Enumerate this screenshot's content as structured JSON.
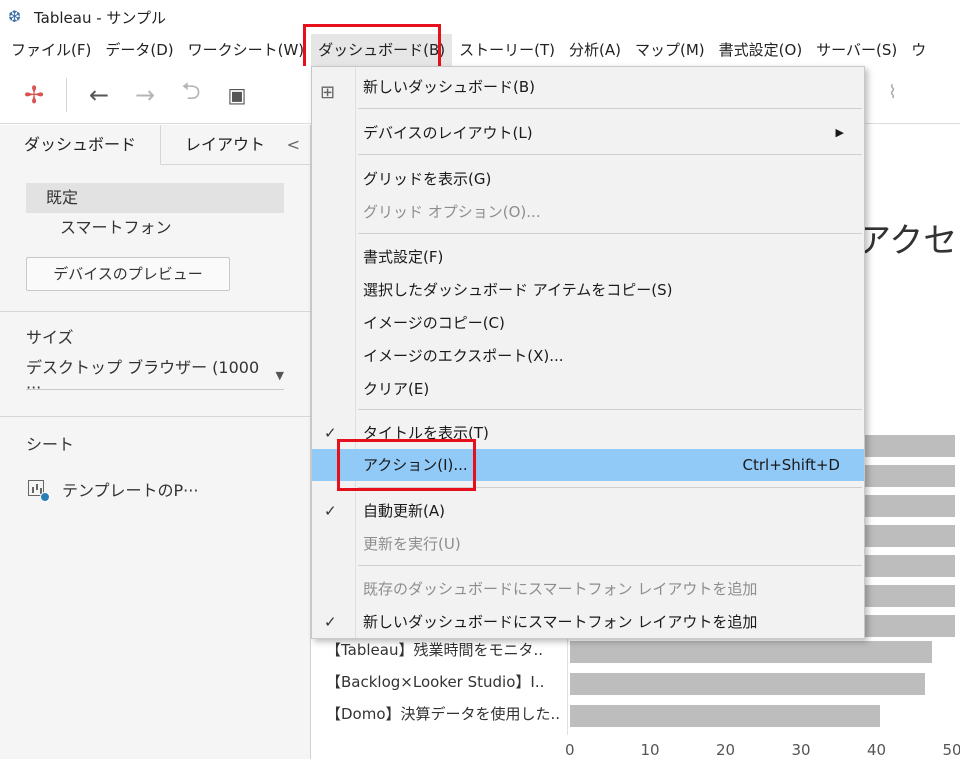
{
  "window": {
    "title": "Tableau - サンプル"
  },
  "menubar": [
    "ファイル(F)",
    "データ(D)",
    "ワークシート(W)",
    "ダッシュボード(B)",
    "ストーリー(T)",
    "分析(A)",
    "マップ(M)",
    "書式設定(O)",
    "サーバー(S)",
    "ウ"
  ],
  "leftpanel": {
    "tabs": [
      "ダッシュボード",
      "レイアウト"
    ],
    "collapse": "<",
    "devices": [
      "既定",
      "スマートフォン"
    ],
    "preview_button": "デバイスのプレビュー",
    "size_label": "サイズ",
    "size_value": "デスクトップ ブラウザー (1000 ···",
    "sheets_label": "シート",
    "sheet_item": "テンプレートのP···"
  },
  "canvas": {
    "title_fragment": "アクセス",
    "bars": [
      {
        "label": "【Tableau】残業時間をモニタ..",
        "value": 48
      },
      {
        "label": "【Backlog×Looker Studio】I..",
        "value": 47
      },
      {
        "label": "【Domo】決算データを使用した..",
        "value": 41
      }
    ],
    "hidden_bar_values": [
      51,
      51,
      51,
      51,
      51,
      51,
      51
    ],
    "axis_ticks": [
      "0",
      "10",
      "20",
      "30",
      "40",
      "50"
    ],
    "axis_max": 50
  },
  "dropdown": {
    "items": [
      {
        "label": "新しいダッシュボード(B)",
        "icon": "new-dashboard-icon"
      },
      {
        "label": "デバイスのレイアウト(L)",
        "submenu": true
      },
      {
        "label": "グリッドを表示(G)"
      },
      {
        "label": "グリッド オプション(O)...",
        "disabled": true
      },
      {
        "label": "書式設定(F)"
      },
      {
        "label": "選択したダッシュボード アイテムをコピー(S)"
      },
      {
        "label": "イメージのコピー(C)"
      },
      {
        "label": "イメージのエクスポート(X)..."
      },
      {
        "label": "クリア(E)"
      },
      {
        "label": "タイトルを表示(T)",
        "checked": true
      },
      {
        "label": "アクション(I)...",
        "shortcut": "Ctrl+Shift+D",
        "highlighted": true
      },
      {
        "label": "自動更新(A)",
        "checked": true
      },
      {
        "label": "更新を実行(U)",
        "disabled": true
      },
      {
        "label": "既存のダッシュボードにスマートフォン レイアウトを追加",
        "disabled": true
      },
      {
        "label": "新しいダッシュボードにスマートフォン レイアウトを追加",
        "checked": true
      }
    ],
    "check_glyph": "✓",
    "arrow_glyph": "▶"
  },
  "colors": {
    "highlight": "#91c9f7",
    "annotation": "#e5101c",
    "bar": "#bdbdbd"
  }
}
